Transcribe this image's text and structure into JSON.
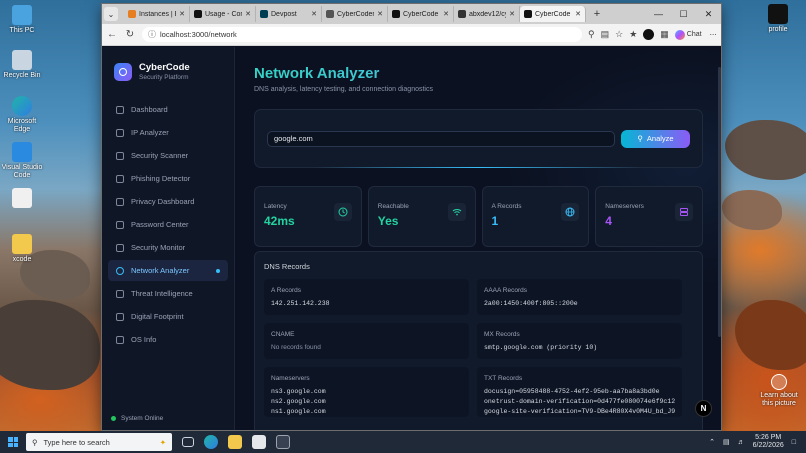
{
  "desktop": {
    "icons": [
      {
        "label": "This PC"
      },
      {
        "label": "Recycle Bin"
      },
      {
        "label": "Microsoft Edge"
      },
      {
        "label": "Visual Studio Code"
      },
      {
        "label": ""
      },
      {
        "label": "xcode"
      }
    ],
    "right_icons": [
      {
        "label": "profile"
      },
      {
        "label": "Learn about this picture"
      }
    ]
  },
  "browser": {
    "tabs": [
      {
        "title": "Instances | El",
        "color": "#e67e22",
        "active": false
      },
      {
        "title": "Usage - Comr",
        "color": "#111111",
        "active": false
      },
      {
        "title": "Devpost",
        "color": "#003e54",
        "active": false
      },
      {
        "title": "CyberCoders |",
        "color": "#555555",
        "active": false
      },
      {
        "title": "CyberCode -",
        "color": "#111111",
        "active": false
      },
      {
        "title": "abxdev12/cyb",
        "color": "#333333",
        "active": false
      },
      {
        "title": "CyberCode -",
        "color": "#111111",
        "active": true
      }
    ],
    "url": "localhost:3000/network",
    "chat_label": "Chat"
  },
  "app": {
    "brand": {
      "name": "CyberCode",
      "subtitle": "Security Platform"
    },
    "nav": [
      {
        "label": "Dashboard",
        "active": false
      },
      {
        "label": "IP Analyzer",
        "active": false
      },
      {
        "label": "Security Scanner",
        "active": false
      },
      {
        "label": "Phishing Detector",
        "active": false
      },
      {
        "label": "Privacy Dashboard",
        "active": false
      },
      {
        "label": "Password Center",
        "active": false
      },
      {
        "label": "Security Monitor",
        "active": false
      },
      {
        "label": "Network Analyzer",
        "active": true
      },
      {
        "label": "Threat Intelligence",
        "active": false
      },
      {
        "label": "Digital Footprint",
        "active": false
      },
      {
        "label": "OS Info",
        "active": false
      }
    ],
    "system_status": "System Online",
    "page_title": "Network Analyzer",
    "page_subtitle": "DNS analysis, latency testing, and connection diagnostics",
    "search_value": "google.com",
    "analyze_label": "Analyze",
    "stats": [
      {
        "label": "Latency",
        "value": "42ms",
        "color": "#22d3a0",
        "icon": "clock-icon"
      },
      {
        "label": "Reachable",
        "value": "Yes",
        "color": "#22d3a0",
        "icon": "wifi-icon"
      },
      {
        "label": "A Records",
        "value": "1",
        "color": "#38bdf8",
        "icon": "globe-icon"
      },
      {
        "label": "Nameservers",
        "value": "4",
        "color": "#a855f7",
        "icon": "server-icon"
      }
    ],
    "dns": {
      "title": "DNS Records",
      "records": [
        {
          "label": "A Records",
          "values": [
            "142.251.142.238"
          ]
        },
        {
          "label": "AAAA Records",
          "values": [
            "2a00:1450:400f:805::200e"
          ]
        },
        {
          "label": "CNAME",
          "values": [
            "No records found"
          ],
          "empty": true
        },
        {
          "label": "MX Records",
          "values": [
            "smtp.google.com (priority 10)"
          ]
        },
        {
          "label": "Nameservers",
          "values": [
            "ns3.google.com",
            "ns2.google.com",
            "ns1.google.com"
          ]
        },
        {
          "label": "TXT Records",
          "values": [
            "docusign=05958488-4752-4ef2-95eb-aa7ba8a3bd0e",
            "onetrust-domain-verification=0d477fe080074e6f9c12bc",
            "google-site-verification=TV9-DBe4R80X4v0M4U_bd_J9cp"
          ]
        }
      ]
    },
    "fab_label": "N"
  },
  "taskbar": {
    "search_placeholder": "Type here to search",
    "time": "5:26 PM",
    "date": "6/22/2026"
  }
}
